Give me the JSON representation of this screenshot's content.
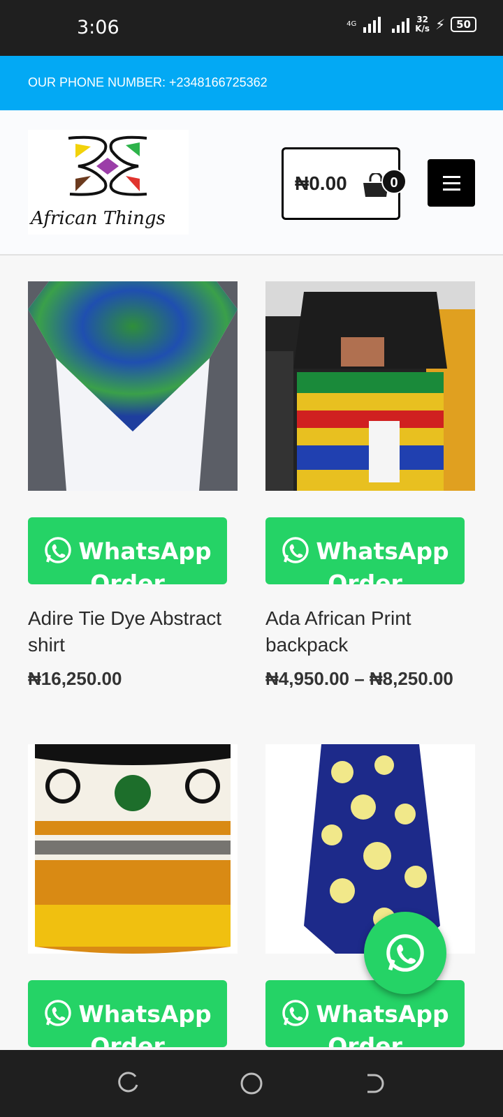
{
  "status_bar": {
    "time": "3:06",
    "network": "4G",
    "speed_value": "32",
    "speed_unit": "K/s",
    "battery": "50"
  },
  "topbar": {
    "phone_text": "OUR PHONE NUMBER: +2348166725362"
  },
  "header": {
    "logo_text": "African Things",
    "cart_amount": "₦0.00",
    "cart_count": "0",
    "menu_icon": "hamburger-menu-icon"
  },
  "products": [
    {
      "title": "Adire Tie Dye Abstract shirt",
      "price": "₦16,250.00",
      "button_label": "WhatsApp Order"
    },
    {
      "title": "Ada African Print backpack",
      "price": "₦4,950.00 – ₦8,250.00",
      "button_label": "WhatsApp Order"
    },
    {
      "title": "",
      "price": "",
      "button_label": "WhatsApp Order"
    },
    {
      "title": "",
      "price": "",
      "button_label": "WhatsApp Order"
    }
  ],
  "colors": {
    "accent_blue": "#03a9f4",
    "whatsapp_green": "#25d366",
    "status_bar": "#1f1f1f"
  },
  "icons": {
    "whatsapp": "whatsapp-icon",
    "cart": "shopping-bag-icon"
  }
}
